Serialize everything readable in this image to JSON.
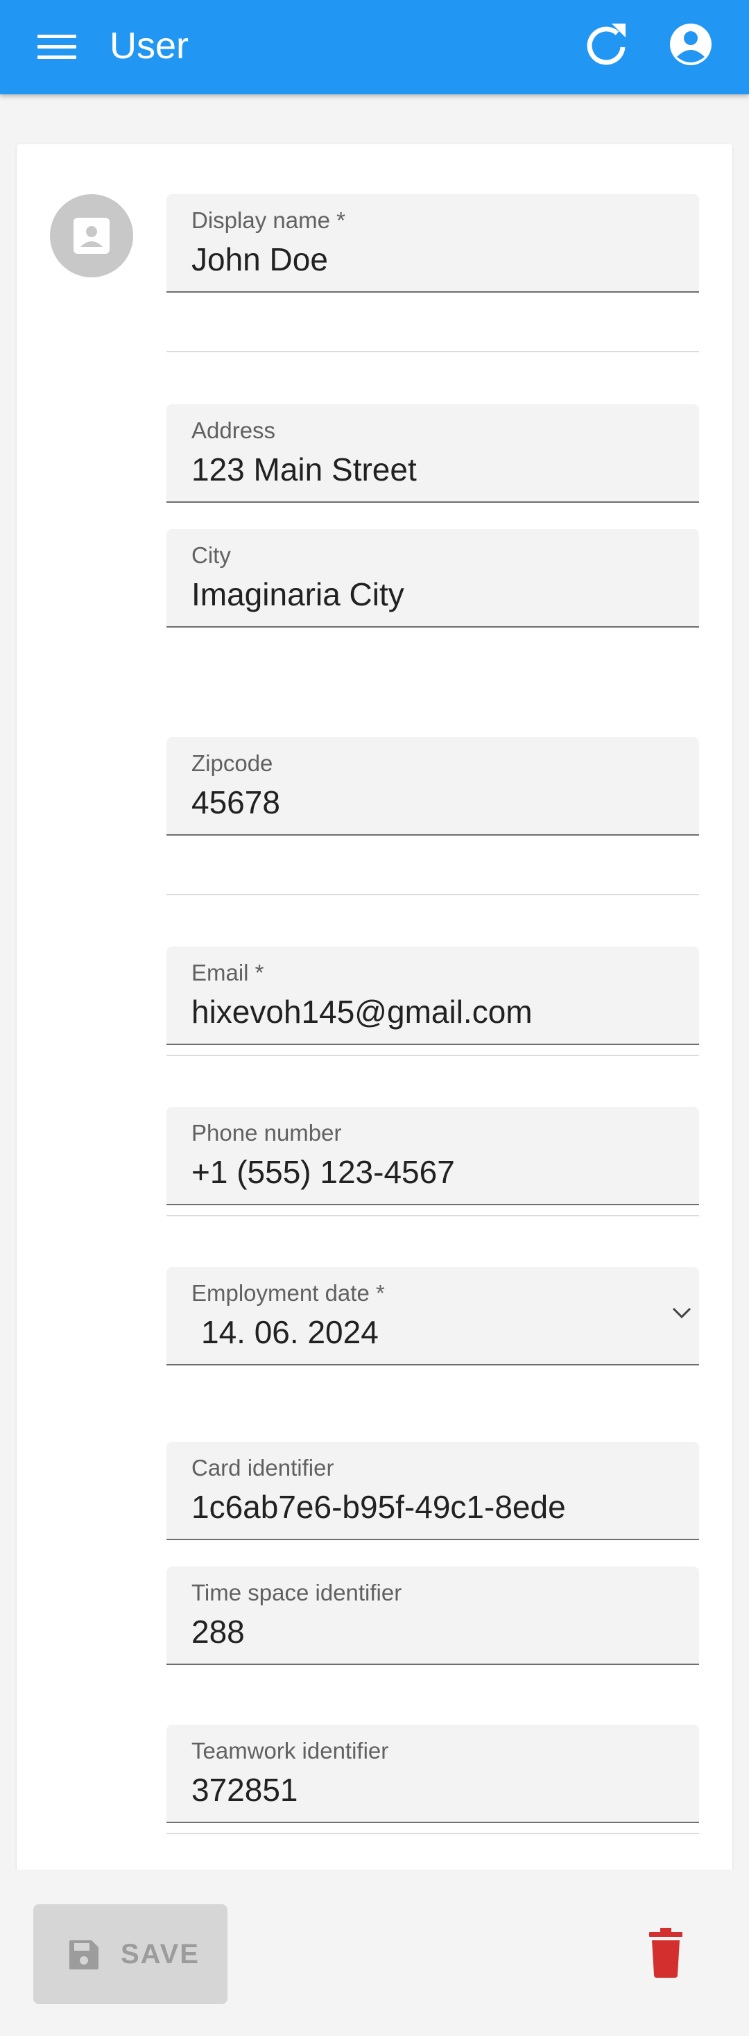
{
  "appbar": {
    "title": "User",
    "background": "#2196f3",
    "icons": {
      "menu": "menu-icon",
      "refresh": "refresh-icon",
      "account": "account-circle-icon"
    }
  },
  "avatar": {
    "icon": "contact-portrait-icon"
  },
  "form": {
    "display_name": {
      "label": "Display name *",
      "value": "John Doe"
    },
    "address": {
      "label": "Address",
      "value": "123 Main Street"
    },
    "city": {
      "label": "City",
      "value": "Imaginaria City"
    },
    "zipcode": {
      "label": "Zipcode",
      "value": "45678"
    },
    "email": {
      "label": "Email *",
      "value": "hixevoh145@gmail.com"
    },
    "phone": {
      "label": "Phone number",
      "value": "+1 (555) 123-4567"
    },
    "employment_date": {
      "label": "Employment date *",
      "value": "14. 06. 2024"
    },
    "card_id": {
      "label": "Card identifier",
      "value": "1c6ab7e6-b95f-49c1-8ede"
    },
    "time_space_id": {
      "label": "Time space identifier",
      "value": "288"
    },
    "teamwork_id": {
      "label": "Teamwork identifier",
      "value": "372851"
    }
  },
  "actions": {
    "save_label": "SAVE",
    "save_disabled": true,
    "save_icon": "floppy-disk-icon",
    "delete_icon": "trash-icon",
    "delete_color": "#d32f2f"
  }
}
